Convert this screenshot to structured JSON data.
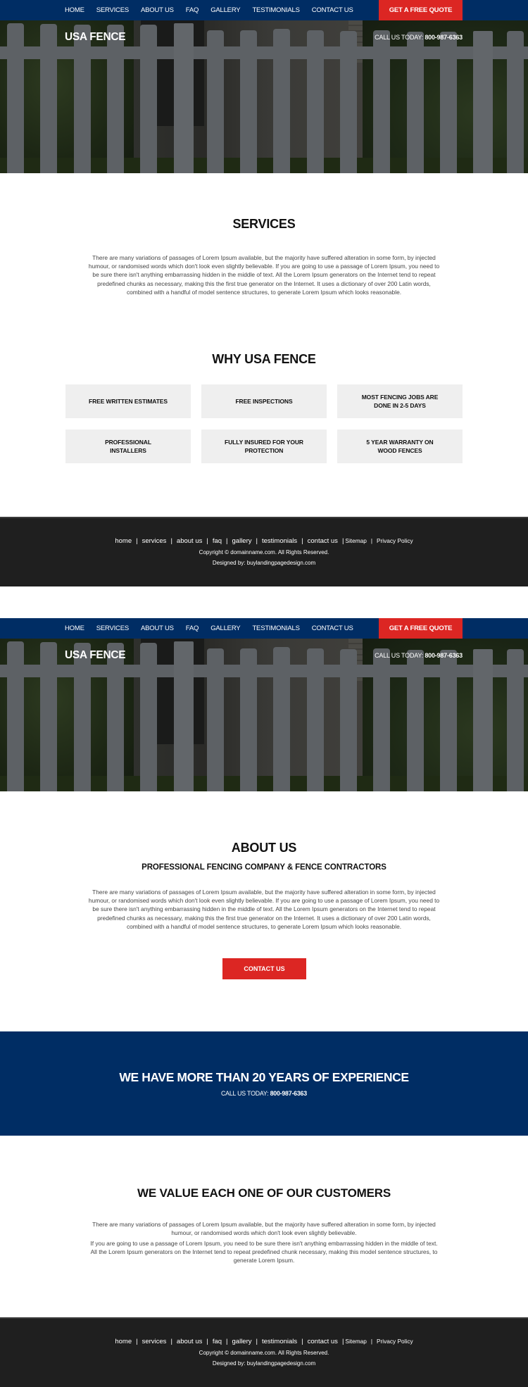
{
  "nav": {
    "items": [
      "HOME",
      "SERVICES",
      "ABOUT US",
      "FAQ",
      "GALLERY",
      "TESTIMONIALS",
      "CONTACT US"
    ],
    "quote_button": "GET A FREE QUOTE"
  },
  "hero": {
    "brand": "USA FENCE",
    "call_label": "CALL US TODAY:",
    "phone": "800-987-6363"
  },
  "services": {
    "title": "SERVICES",
    "text": "There are many variations of passages of Lorem Ipsum available, but the majority have suffered alteration in some form, by injected humour, or randomised words which don't look even slightly believable. If you are going to use a passage of Lorem Ipsum, you need to be sure there isn't anything embarrassing hidden in the middle of text. All the Lorem Ipsum generators on the Internet tend to repeat predefined chunks as necessary, making this the first true generator on the Internet. It uses a dictionary of over 200 Latin words, combined with a handful of model sentence structures, to generate Lorem Ipsum which looks reasonable."
  },
  "why": {
    "title": "WHY USA FENCE",
    "items": [
      "FREE WRITTEN ESTIMATES",
      "FREE INSPECTIONS",
      "MOST FENCING JOBS ARE DONE IN 2-5 DAYS",
      "PROFESSIONAL INSTALLERS",
      "FULLY INSURED FOR YOUR PROTECTION",
      "5 YEAR WARRANTY ON WOOD FENCES"
    ]
  },
  "footer": {
    "links": [
      "home",
      "services",
      "about us",
      "faq",
      "gallery",
      "testimonials",
      "contact us"
    ],
    "sitemap": "Sitemap",
    "privacy": "Privacy Policy",
    "copyright": "Copyright © domainname.com. All Rights Reserved.",
    "designed_by": "Designed by: buylandingpagedesign.com"
  },
  "about": {
    "title": "ABOUT US",
    "subtitle": "PROFESSIONAL FENCING COMPANY & FENCE CONTRACTORS",
    "text": "There are many variations of passages of Lorem Ipsum available, but the majority have suffered alteration in some form, by injected humour, or randomised words which don't look even slightly believable. If you are going to use a passage of Lorem Ipsum, you need to be sure there isn't anything embarrassing hidden in the middle of text. All the Lorem Ipsum generators on the Internet tend to repeat predefined chunks as necessary, making this the first true generator on the Internet. It uses a dictionary of over 200 Latin words, combined with a handful of model sentence structures, to generate Lorem Ipsum which looks reasonable.",
    "cta": "CONTACT US"
  },
  "experience": {
    "heading": "WE HAVE MORE THAN 20 YEARS OF EXPERIENCE",
    "call_label": "CALL US TODAY:",
    "phone": "800-987-6363"
  },
  "customers": {
    "title": "WE VALUE EACH ONE OF OUR CUSTOMERS",
    "text1": "There are many variations of passages of Lorem Ipsum available, but the majority have suffered alteration in some form, by injected humour, or randomised words which don't look even slightly believable.",
    "text2": "If you are going to use a passage of Lorem Ipsum, you need to be sure there isn't anything embarrassing hidden in the middle of text. All the Lorem Ipsum generators on the Internet tend to repeat predefined chunk necessary, making this model sentence structures, to generate Lorem Ipsum."
  },
  "colors": {
    "nav_blue": "#002d64",
    "accent_red": "#dc2623",
    "footer_dark": "#1f1f1f",
    "card_gray": "#efefef"
  }
}
